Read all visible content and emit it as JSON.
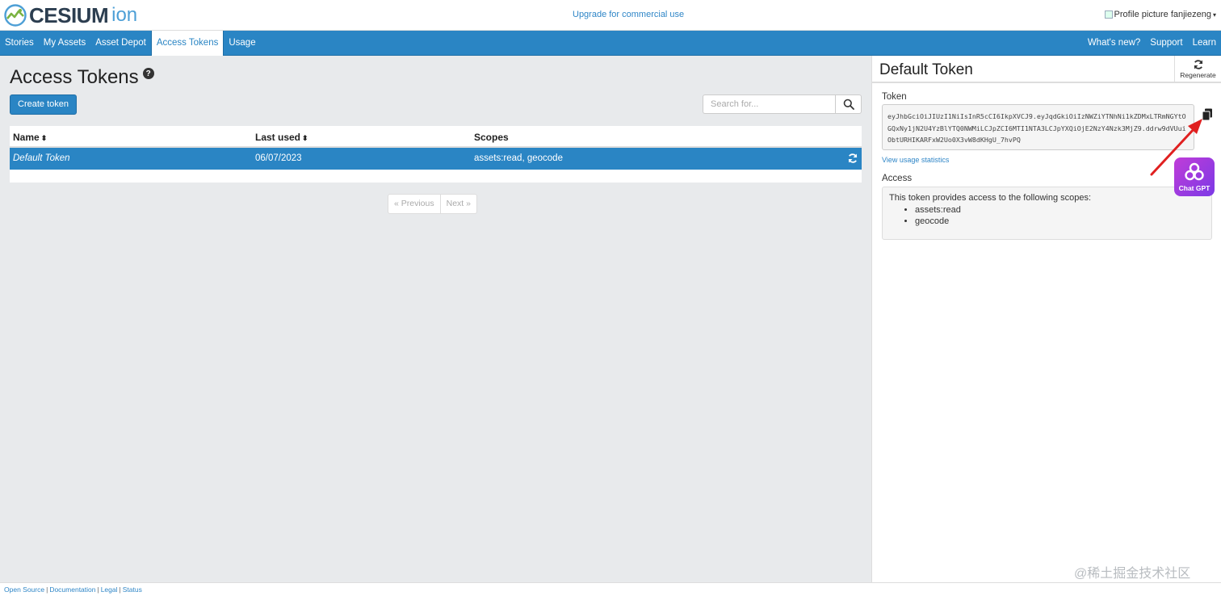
{
  "header": {
    "logo_text": "CESIUM",
    "logo_suffix": "ion",
    "upgrade_link": "Upgrade for commercial use",
    "profile_text": "Profile picture fanjiezeng",
    "profile_caret": "▾"
  },
  "nav": {
    "left": [
      "Stories",
      "My Assets",
      "Asset Depot",
      "Access Tokens",
      "Usage"
    ],
    "active": "Access Tokens",
    "right": [
      "What's new?",
      "Support",
      "Learn"
    ]
  },
  "main": {
    "title": "Access Tokens",
    "help_glyph": "?",
    "create_button": "Create token",
    "search_placeholder": "Search for...",
    "table": {
      "columns": [
        {
          "label": "Name",
          "sortable": true
        },
        {
          "label": "Last used",
          "sortable": true
        },
        {
          "label": "Scopes",
          "sortable": false
        }
      ],
      "sort_glyph": "⬍",
      "rows": [
        {
          "name": "Default Token",
          "last_used": "06/07/2023",
          "scopes": "assets:read, geocode",
          "selected": true
        }
      ]
    },
    "pagination": {
      "previous": "« Previous",
      "next": "Next »"
    }
  },
  "panel": {
    "title": "Default Token",
    "regenerate_label": "Regenerate",
    "token_label": "Token",
    "token_value": "eyJhbGciOiJIUzI1NiIsInR5cCI6IkpXVCJ9.eyJqdGkiOiIzNWZiYTNhNi1kZDMxLTRmNGYtOGQxNy1jN2U4YzBlYTQ0NWMiLCJpZCI6MTI1NTA3LCJpYXQiOjE2NzY4Nzk3MjZ9.ddrw9dVUuiObtURHIKARFxW2Uo0X3vW8dKHgU_7hvPQ",
    "usage_link": "View usage statistics",
    "access_label": "Access",
    "access_intro": "This token provides access to the following scopes:",
    "scopes": [
      "assets:read",
      "geocode"
    ]
  },
  "overlay": {
    "chatgpt_label": "Chat GPT",
    "watermark": "@稀土掘金技术社区",
    "arrow_color": "#e02020"
  },
  "footer": {
    "links": [
      "Open Source",
      "Documentation",
      "Legal",
      "Status"
    ],
    "separator": "|"
  },
  "colors": {
    "brand_blue": "#2a85c4",
    "link_blue": "#2f86c7",
    "page_bg": "#e8eaec"
  }
}
